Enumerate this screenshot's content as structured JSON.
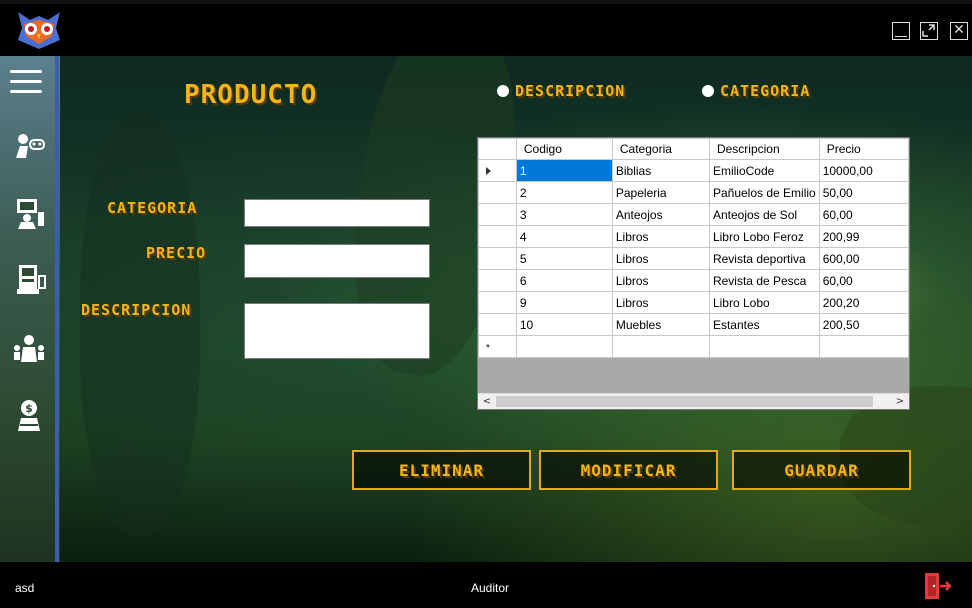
{
  "window": {
    "logo_icon": "owl-logo-icon",
    "controls": {
      "minimize": "minimize-icon",
      "maximize": "maximize-icon",
      "close": "close-icon",
      "close_glyph": "✕"
    }
  },
  "sidebar": {
    "menu_icon": "hamburger-menu-icon",
    "items": [
      {
        "icon": "gamepad-user-icon"
      },
      {
        "icon": "computer-user-icon"
      },
      {
        "icon": "register-machine-icon"
      },
      {
        "icon": "group-users-icon"
      },
      {
        "icon": "money-user-icon"
      }
    ]
  },
  "page": {
    "title": "PRODUCTO",
    "filter_options": [
      {
        "label": "DESCRIPCION"
      },
      {
        "label": "CATEGORIA"
      }
    ]
  },
  "form": {
    "categoria": {
      "label": "CATEGORIA",
      "value": ""
    },
    "precio": {
      "label": "PRECIO",
      "value": ""
    },
    "descripcion": {
      "label": "DESCRIPCION",
      "value": ""
    }
  },
  "grid": {
    "columns": [
      "Codigo",
      "Categoria",
      "Descripcion",
      "Precio"
    ],
    "rows": [
      [
        "1",
        "Biblias",
        "EmilioCode",
        "10000,00"
      ],
      [
        "2",
        "Papeleria",
        "Pañuelos de Emilio",
        "50,00"
      ],
      [
        "3",
        "Anteojos",
        "Anteojos de  Sol",
        "60,00"
      ],
      [
        "4",
        "Libros",
        "Libro Lobo Feroz",
        "200,99"
      ],
      [
        "5",
        "Libros",
        "Revista deportiva",
        "600,00"
      ],
      [
        "6",
        "Libros",
        "Revista de Pesca",
        "60,00"
      ],
      [
        "9",
        "Libros",
        "Libro Lobo",
        "200,20"
      ],
      [
        "10",
        "Muebles",
        "Estantes",
        "200,50"
      ]
    ],
    "new_row_marker": "*",
    "scroll_left": "<",
    "scroll_right": ">"
  },
  "actions": {
    "eliminar": "ELIMINAR",
    "modificar": "MODIFICAR",
    "guardar": "GUARDAR"
  },
  "status": {
    "user": "asd",
    "role": "Auditor",
    "exit_icon": "exit-door-icon"
  },
  "colors": {
    "accent_gold": "#f2b51b",
    "selection_blue": "#0078d7",
    "sidebar_edge": "#3d5ea8",
    "exit_red": "#e23b3b"
  }
}
